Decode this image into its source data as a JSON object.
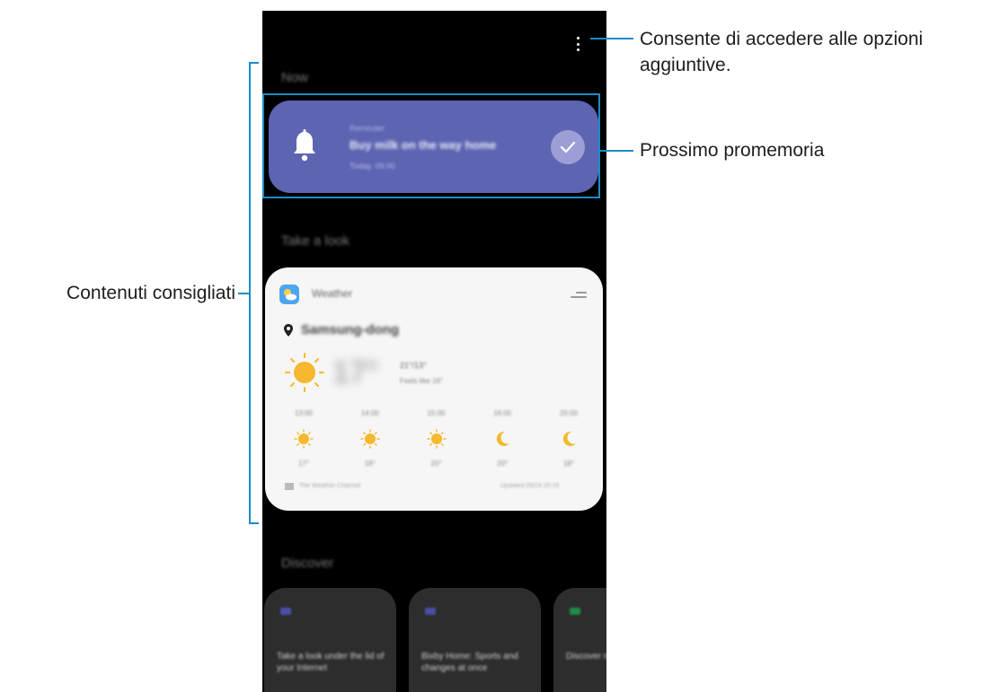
{
  "menu": {
    "icon": "more-vertical-icon"
  },
  "sections": {
    "now": "Now",
    "take_a_look": "Take a look",
    "discover": "Discover"
  },
  "reminder": {
    "icon": "bell-icon",
    "category": "Reminder",
    "title": "Buy milk on the way home",
    "time": "Today, 09:00",
    "complete_icon": "check-icon",
    "card_color": "#5d64b2"
  },
  "weather": {
    "app_icon": "weather-icon",
    "app_name": "Weather",
    "location": "Samsung-dong",
    "current_temp": "17°",
    "hi_lo": "21°/13°",
    "feels_like": "Feels like 16°",
    "forecast": [
      {
        "time": "13:00",
        "icon": "sun-icon",
        "temp": "17°"
      },
      {
        "time": "14:00",
        "icon": "sun-icon",
        "temp": "18°"
      },
      {
        "time": "15:00",
        "icon": "sun-icon",
        "temp": "20°"
      },
      {
        "time": "16:00",
        "icon": "moon-icon",
        "temp": "20°"
      },
      {
        "time": "20:00",
        "icon": "moon-icon",
        "temp": "18°"
      }
    ],
    "provider": "The Weather Channel",
    "updated": "Updated 09/24 20:15"
  },
  "discover": [
    {
      "text": "Take a look under the lid of your Internet",
      "icon_color": "#4a4fa8"
    },
    {
      "text": "Bixby Home: Sports and changes at once",
      "icon_color": "#4a4fa8"
    },
    {
      "text": "Discover new",
      "icon_color": "#1f8c4a"
    }
  ],
  "callouts": {
    "options": "Consente di accedere alle opzioni aggiuntive.",
    "reminder": "Prossimo promemoria",
    "content": "Contenuti consigliati"
  },
  "accent_color": "#1a8cc8"
}
